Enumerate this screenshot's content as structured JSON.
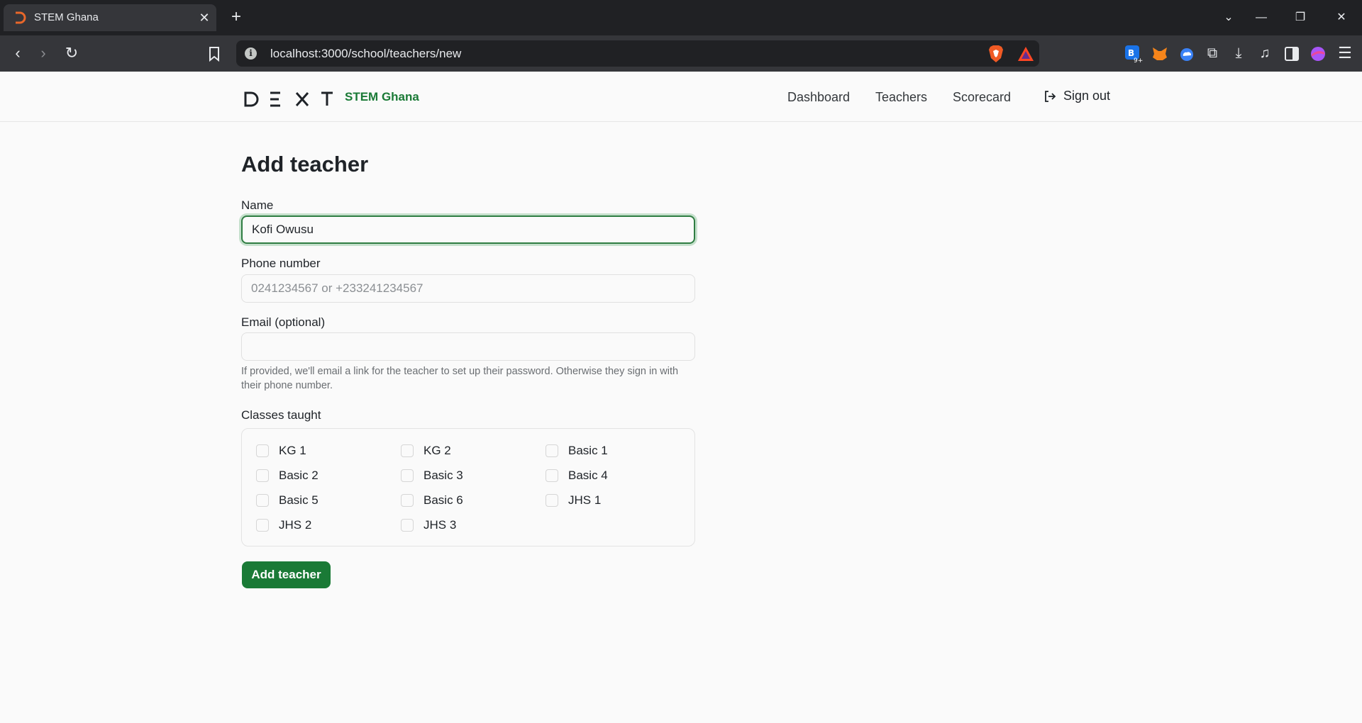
{
  "browser": {
    "tab_title": "STEM Ghana",
    "url": "localhost:3000/school/teachers/new",
    "extension_badge": "9+"
  },
  "header": {
    "logo_letters": [
      "D",
      "E",
      "X",
      "T"
    ],
    "brand": "STEM Ghana",
    "nav": [
      "Dashboard",
      "Teachers",
      "Scorecard"
    ],
    "signout": "Sign out"
  },
  "form": {
    "title": "Add teacher",
    "name_label": "Name",
    "name_value": "Kofi Owusu",
    "phone_label": "Phone number",
    "phone_placeholder": "0241234567 or +233241234567",
    "email_label": "Email (optional)",
    "email_value": "",
    "email_help": "If provided, we'll email a link for the teacher to set up their password. Otherwise they sign in with their phone number.",
    "classes_label": "Classes taught",
    "classes": [
      "KG 1",
      "KG 2",
      "Basic 1",
      "Basic 2",
      "Basic 3",
      "Basic 4",
      "Basic 5",
      "Basic 6",
      "JHS 1",
      "JHS 2",
      "JHS 3"
    ],
    "submit": "Add teacher"
  },
  "colors": {
    "brand_green": "#1a7a36",
    "tab_bar": "#202124",
    "toolbar": "#35363a"
  }
}
